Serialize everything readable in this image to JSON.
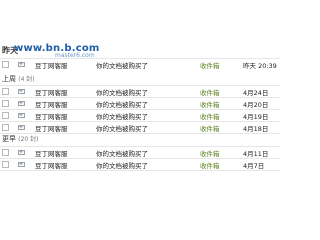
{
  "header": {
    "top_group_label": "昨天",
    "watermark_main": "www.bn.b.com",
    "watermark_sub": "master6.com"
  },
  "groups": [
    {
      "label": "上周",
      "count": "(4 封)"
    },
    {
      "label": "更早",
      "count": "(20 封)"
    }
  ],
  "rows": [
    {
      "sender": "豆丁网客服",
      "subject": "你的文档被购买了",
      "folder": "收件箱",
      "date": "昨天 20:39"
    },
    {
      "sender": "豆丁网客服",
      "subject": "你的文档被购买了",
      "folder": "收件箱",
      "date": "4月24日"
    },
    {
      "sender": "豆丁网客服",
      "subject": "你的文档被购买了",
      "folder": "收件箱",
      "date": "4月20日"
    },
    {
      "sender": "豆丁网客服",
      "subject": "你的文档被购买了",
      "folder": "收件箱",
      "date": "4月19日"
    },
    {
      "sender": "豆丁网客服",
      "subject": "你的文档被购买了",
      "folder": "收件箱",
      "date": "4月18日"
    },
    {
      "sender": "豆丁网客服",
      "subject": "你的文档被购买了",
      "folder": "收件箱",
      "date": "4月11日"
    },
    {
      "sender": "豆丁网客服",
      "subject": "你的文档被购买了",
      "folder": "收件箱",
      "date": "4月7日"
    }
  ],
  "icons": {
    "checkbox": "checkbox",
    "mail": "mail-icon"
  }
}
